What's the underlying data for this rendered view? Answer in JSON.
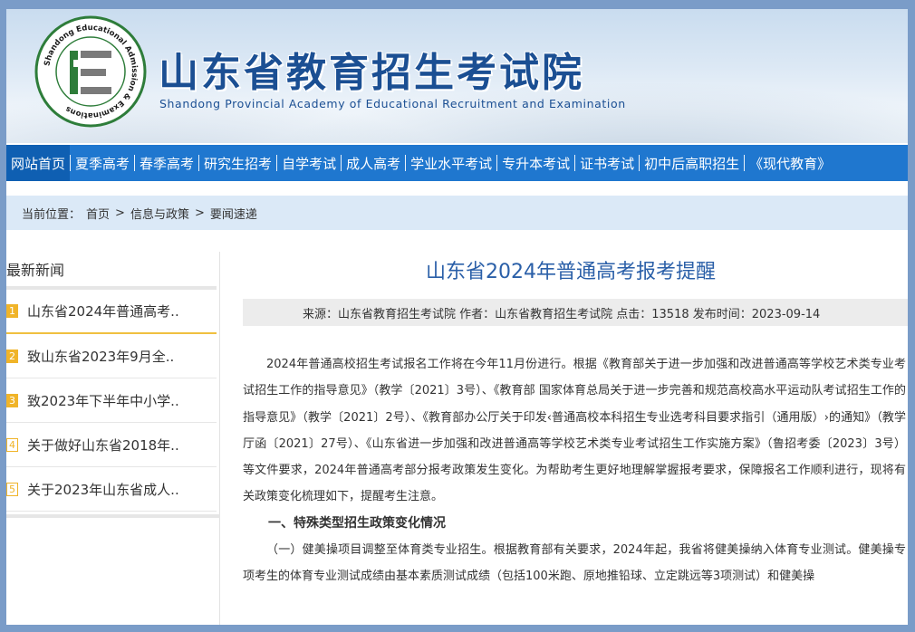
{
  "header": {
    "title": "山东省教育招生考试院",
    "subtitle": "Shandong Provincial Academy of Educational Recruitment and Examination",
    "logo_ring_text": "Shandong Educational Admission & Examinations",
    "logo_bottom_text": "山东省教育招生考试院",
    "brand_color": "#1b4f93"
  },
  "nav": {
    "color": "#1f77cf",
    "items": [
      {
        "label": "网站首页"
      },
      {
        "label": "夏季高考"
      },
      {
        "label": "春季高考"
      },
      {
        "label": "研究生招考"
      },
      {
        "label": "自学考试"
      },
      {
        "label": "成人高考"
      },
      {
        "label": "学业水平考试"
      },
      {
        "label": "专升本考试"
      },
      {
        "label": "证书考试"
      },
      {
        "label": "初中后高职招生"
      },
      {
        "label": "《现代教育》"
      }
    ]
  },
  "breadcrumb": {
    "prefix": "当前位置：",
    "items": [
      "首页",
      ">",
      "信息与政策",
      ">",
      "要闻速递"
    ]
  },
  "sidebar": {
    "heading": "最新新闻",
    "items": [
      {
        "num": "1",
        "label": "山东省2024年普通高考.."
      },
      {
        "num": "2",
        "label": "致山东省2023年9月全.."
      },
      {
        "num": "3",
        "label": "致2023年下半年中小学.."
      },
      {
        "num": "4",
        "label": "关于做好山东省2018年.."
      },
      {
        "num": "5",
        "label": "关于2023年山东省成人.."
      }
    ]
  },
  "article": {
    "title": "山东省2024年普通高考报考提醒",
    "meta": "来源：山东省教育招生考试院 作者：山东省教育招生考试院 点击：13518 发布时间：2023-09-14",
    "paragraph1": "2024年普通高校招生考试报名工作将在今年11月份进行。根据《教育部关于进一步加强和改进普通高等学校艺术类专业考试招生工作的指导意见》（教学〔2021〕3号）、《教育部 国家体育总局关于进一步完善和规范高校高水平运动队考试招生工作的指导意见》（教学〔2021〕2号）、《教育部办公厅关于印发‹普通高校本科招生专业选考科目要求指引（通用版）›的通知》（教学厅函〔2021〕27号）、《山东省进一步加强和改进普通高等学校艺术类专业考试招生工作实施方案》（鲁招考委〔2023〕3号）等文件要求，2024年普通高考部分报考政策发生变化。为帮助考生更好地理解掌握报考要求，保障报名工作顺利进行，现将有关政策变化梳理如下，提醒考生注意。",
    "section1": "一、特殊类型招生政策变化情况",
    "paragraph2": "（一）健美操项目调整至体育类专业招生。根据教育部有关要求，2024年起，我省将健美操纳入体育专业测试。健美操专项考生的体育专业测试成绩由基本素质测试成绩（包括100米跑、原地推铅球、立定跳远等3项测试）和健美操"
  }
}
